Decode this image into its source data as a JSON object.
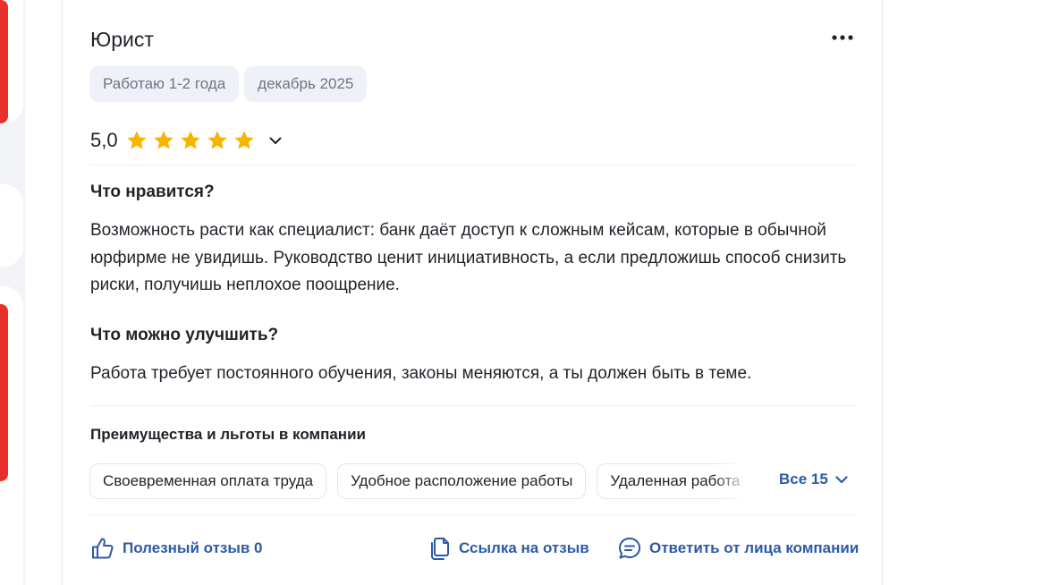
{
  "review": {
    "title": "Юрист",
    "tags": [
      "Работаю 1-2 года",
      "декабрь 2025"
    ],
    "rating": {
      "value_text": "5,0",
      "stars_filled": 5,
      "stars_total": 5,
      "star_color": "#f7b500"
    },
    "likes": {
      "heading": "Что нравится?",
      "text": "Возможность расти как специалист: банк даёт доступ к сложным кейсам, которые в обычной юрфирме не увидишь. Руководство ценит инициативность, а если предложишь способ снизить риски, получишь неплохое поощрение."
    },
    "improve": {
      "heading": "Что можно улучшить?",
      "text": "Работа требует постоянного обучения, законы меняются, а ты должен быть в теме."
    },
    "benefits": {
      "title": "Преимущества и льготы в компании",
      "chips": [
        "Своевременная оплата труда",
        "Удобное расположение работы",
        "Удаленная работа"
      ],
      "all_label": "Все 15"
    },
    "actions": {
      "useful": "Полезный отзыв 0",
      "link": "Ссылка на отзыв",
      "reply": "Ответить от лица компании"
    }
  },
  "colors": {
    "accent": "#2c5aa6",
    "brand_red": "#e8302b",
    "tag_bg": "#eef1f7",
    "text": "#1f2329"
  },
  "icons": {
    "more": "more-dots-icon",
    "expand": "chevron-down-icon",
    "useful": "thumbs-up-icon",
    "link": "copy-link-icon",
    "reply": "chat-bubble-icon",
    "star": "star-icon"
  }
}
